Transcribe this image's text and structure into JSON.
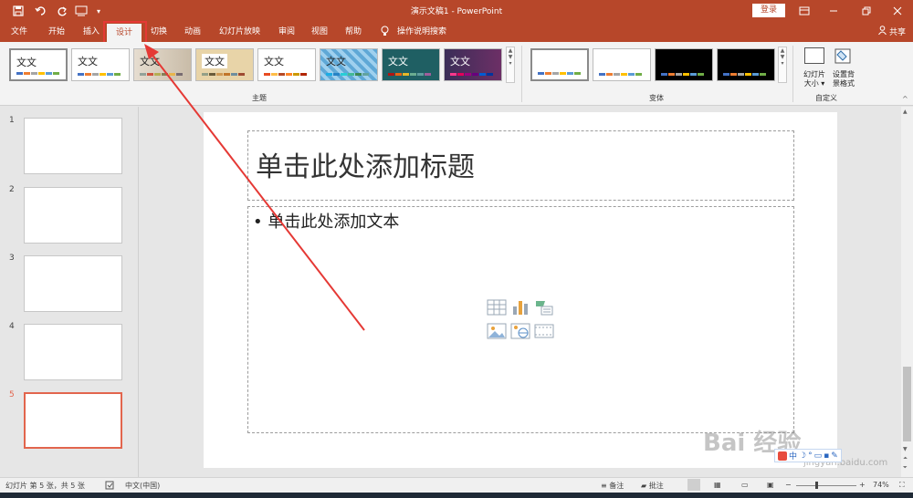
{
  "titlebar": {
    "document_title": "演示文稿1 - PowerPoint",
    "login_label": "登录",
    "quick_access": [
      "save-icon",
      "undo-icon",
      "redo-icon",
      "touch-mode-icon",
      "customize-icon"
    ]
  },
  "tabs": {
    "file": "文件",
    "home": "开始",
    "insert": "插入",
    "design": "设计",
    "transitions": "切换",
    "animations": "动画",
    "slideshow": "幻灯片放映",
    "review": "审阅",
    "view": "视图",
    "help": "帮助",
    "tell_me": "操作说明搜索",
    "share": "共享"
  },
  "ribbon": {
    "themes_label": "主题",
    "theme_sample_text": "文文",
    "variants_label": "变体",
    "customize_label": "自定义",
    "slide_size_label_1": "幻灯片",
    "slide_size_label_2": "大小 ▾",
    "format_bg_label_1": "设置背",
    "format_bg_label_2": "景格式"
  },
  "slides": {
    "numbers": [
      "1",
      "2",
      "3",
      "4",
      "5"
    ],
    "selected": "5"
  },
  "slide": {
    "title_placeholder": "单击此处添加标题",
    "body_placeholder": "• 单击此处添加文本"
  },
  "statusbar": {
    "slide_info": "幻灯片 第 5 张，共 5 张",
    "language": "中文(中国)",
    "notes": "备注",
    "comments": "批注",
    "zoom": "74%"
  },
  "watermark": {
    "text": "Bai 经验",
    "sub": "jingyan.baidu.com"
  },
  "colors": {
    "accent": "#b7472a",
    "annotation": "#e53935",
    "selected_thumb": "#e2654d"
  }
}
